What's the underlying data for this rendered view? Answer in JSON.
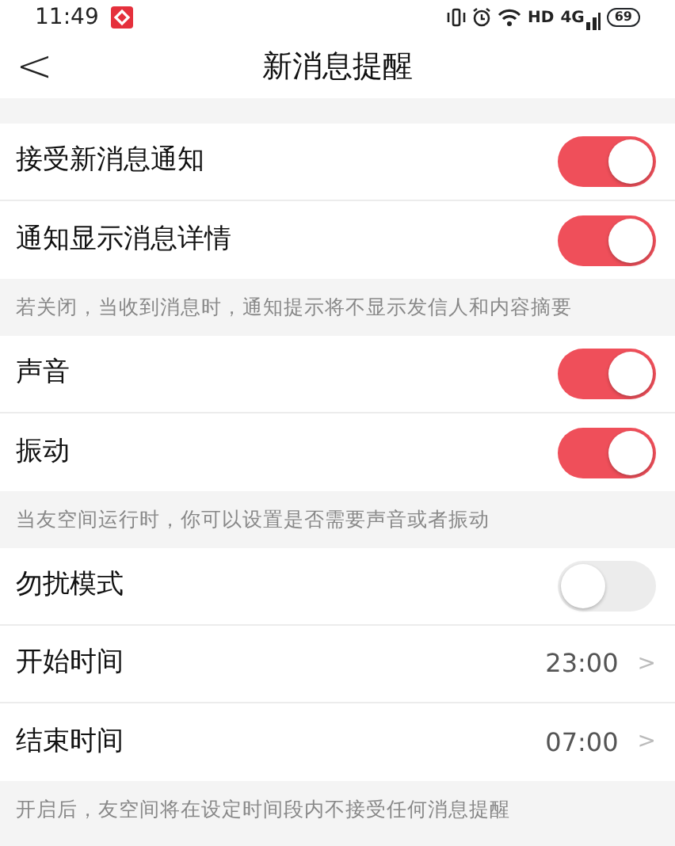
{
  "status_bar": {
    "time": "11:49",
    "network_label": "HD",
    "signal_label": "4G",
    "battery": "69"
  },
  "header": {
    "back": "<",
    "title": "新消息提醒"
  },
  "sections": [
    {
      "items": [
        {
          "kind": "toggle",
          "label": "接受新消息通知",
          "on": true
        },
        {
          "kind": "toggle",
          "label": "通知显示消息详情",
          "on": true
        }
      ],
      "note": "若关闭，当收到消息时，通知提示将不显示发信人和内容摘要"
    },
    {
      "items": [
        {
          "kind": "toggle",
          "label": "声音",
          "on": true
        },
        {
          "kind": "toggle",
          "label": "振动",
          "on": true
        }
      ],
      "note": "当友空间运行时，你可以设置是否需要声音或者振动"
    },
    {
      "items": [
        {
          "kind": "toggle",
          "label": "勿扰模式",
          "on": false
        },
        {
          "kind": "value",
          "label": "开始时间",
          "value": "23:00",
          "chevron": ">"
        },
        {
          "kind": "value",
          "label": "结束时间",
          "value": "07:00",
          "chevron": ">"
        }
      ],
      "note": "开启后，友空间将在设定时间段内不接受任何消息提醒"
    }
  ]
}
